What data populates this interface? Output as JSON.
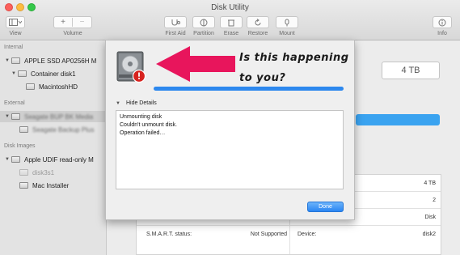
{
  "window": {
    "title": "Disk Utility"
  },
  "toolbar": {
    "view_label": "View",
    "volume_label": "Volume",
    "first_aid_label": "First Aid",
    "partition_label": "Partition",
    "erase_label": "Erase",
    "restore_label": "Restore",
    "mount_label": "Mount",
    "info_label": "Info"
  },
  "sidebar": {
    "internal_header": "Internal",
    "internal_items": [
      {
        "label": "APPLE SSD AP0256H M",
        "level": 0
      },
      {
        "label": "Container disk1",
        "level": 1
      },
      {
        "label": "MacintoshHD",
        "level": 2
      }
    ],
    "external_header": "External",
    "external_items": [
      {
        "label": "Seagate BUP BK Media",
        "level": 0
      },
      {
        "label": "Seagate Backup Plus",
        "level": 1
      }
    ],
    "images_header": "Disk Images",
    "image_items": [
      {
        "label": "Apple UDIF read-only M",
        "level": 0
      },
      {
        "label": "disk3s1",
        "level": 1
      },
      {
        "label": "Mac Installer",
        "level": 1
      }
    ]
  },
  "main": {
    "capacity": "4 TB",
    "info": {
      "rows": [
        {
          "right_value": "4 TB"
        },
        {
          "right_value": "2"
        },
        {
          "right_value": "Disk"
        },
        {
          "left_label": "S.M.A.R.T. status:",
          "left_value": "Not Supported",
          "right_label": "Device:",
          "right_value": "disk2"
        }
      ]
    }
  },
  "sheet": {
    "progress": 1.0,
    "details_toggle": "Hide Details",
    "log": [
      "Unmounting disk",
      "Couldn't unmount disk.",
      "Operation failed…"
    ],
    "done_label": "Done"
  },
  "annotation": {
    "line1": "Is this happening",
    "line2": "to you?",
    "arrow_color": "#e8155c"
  }
}
